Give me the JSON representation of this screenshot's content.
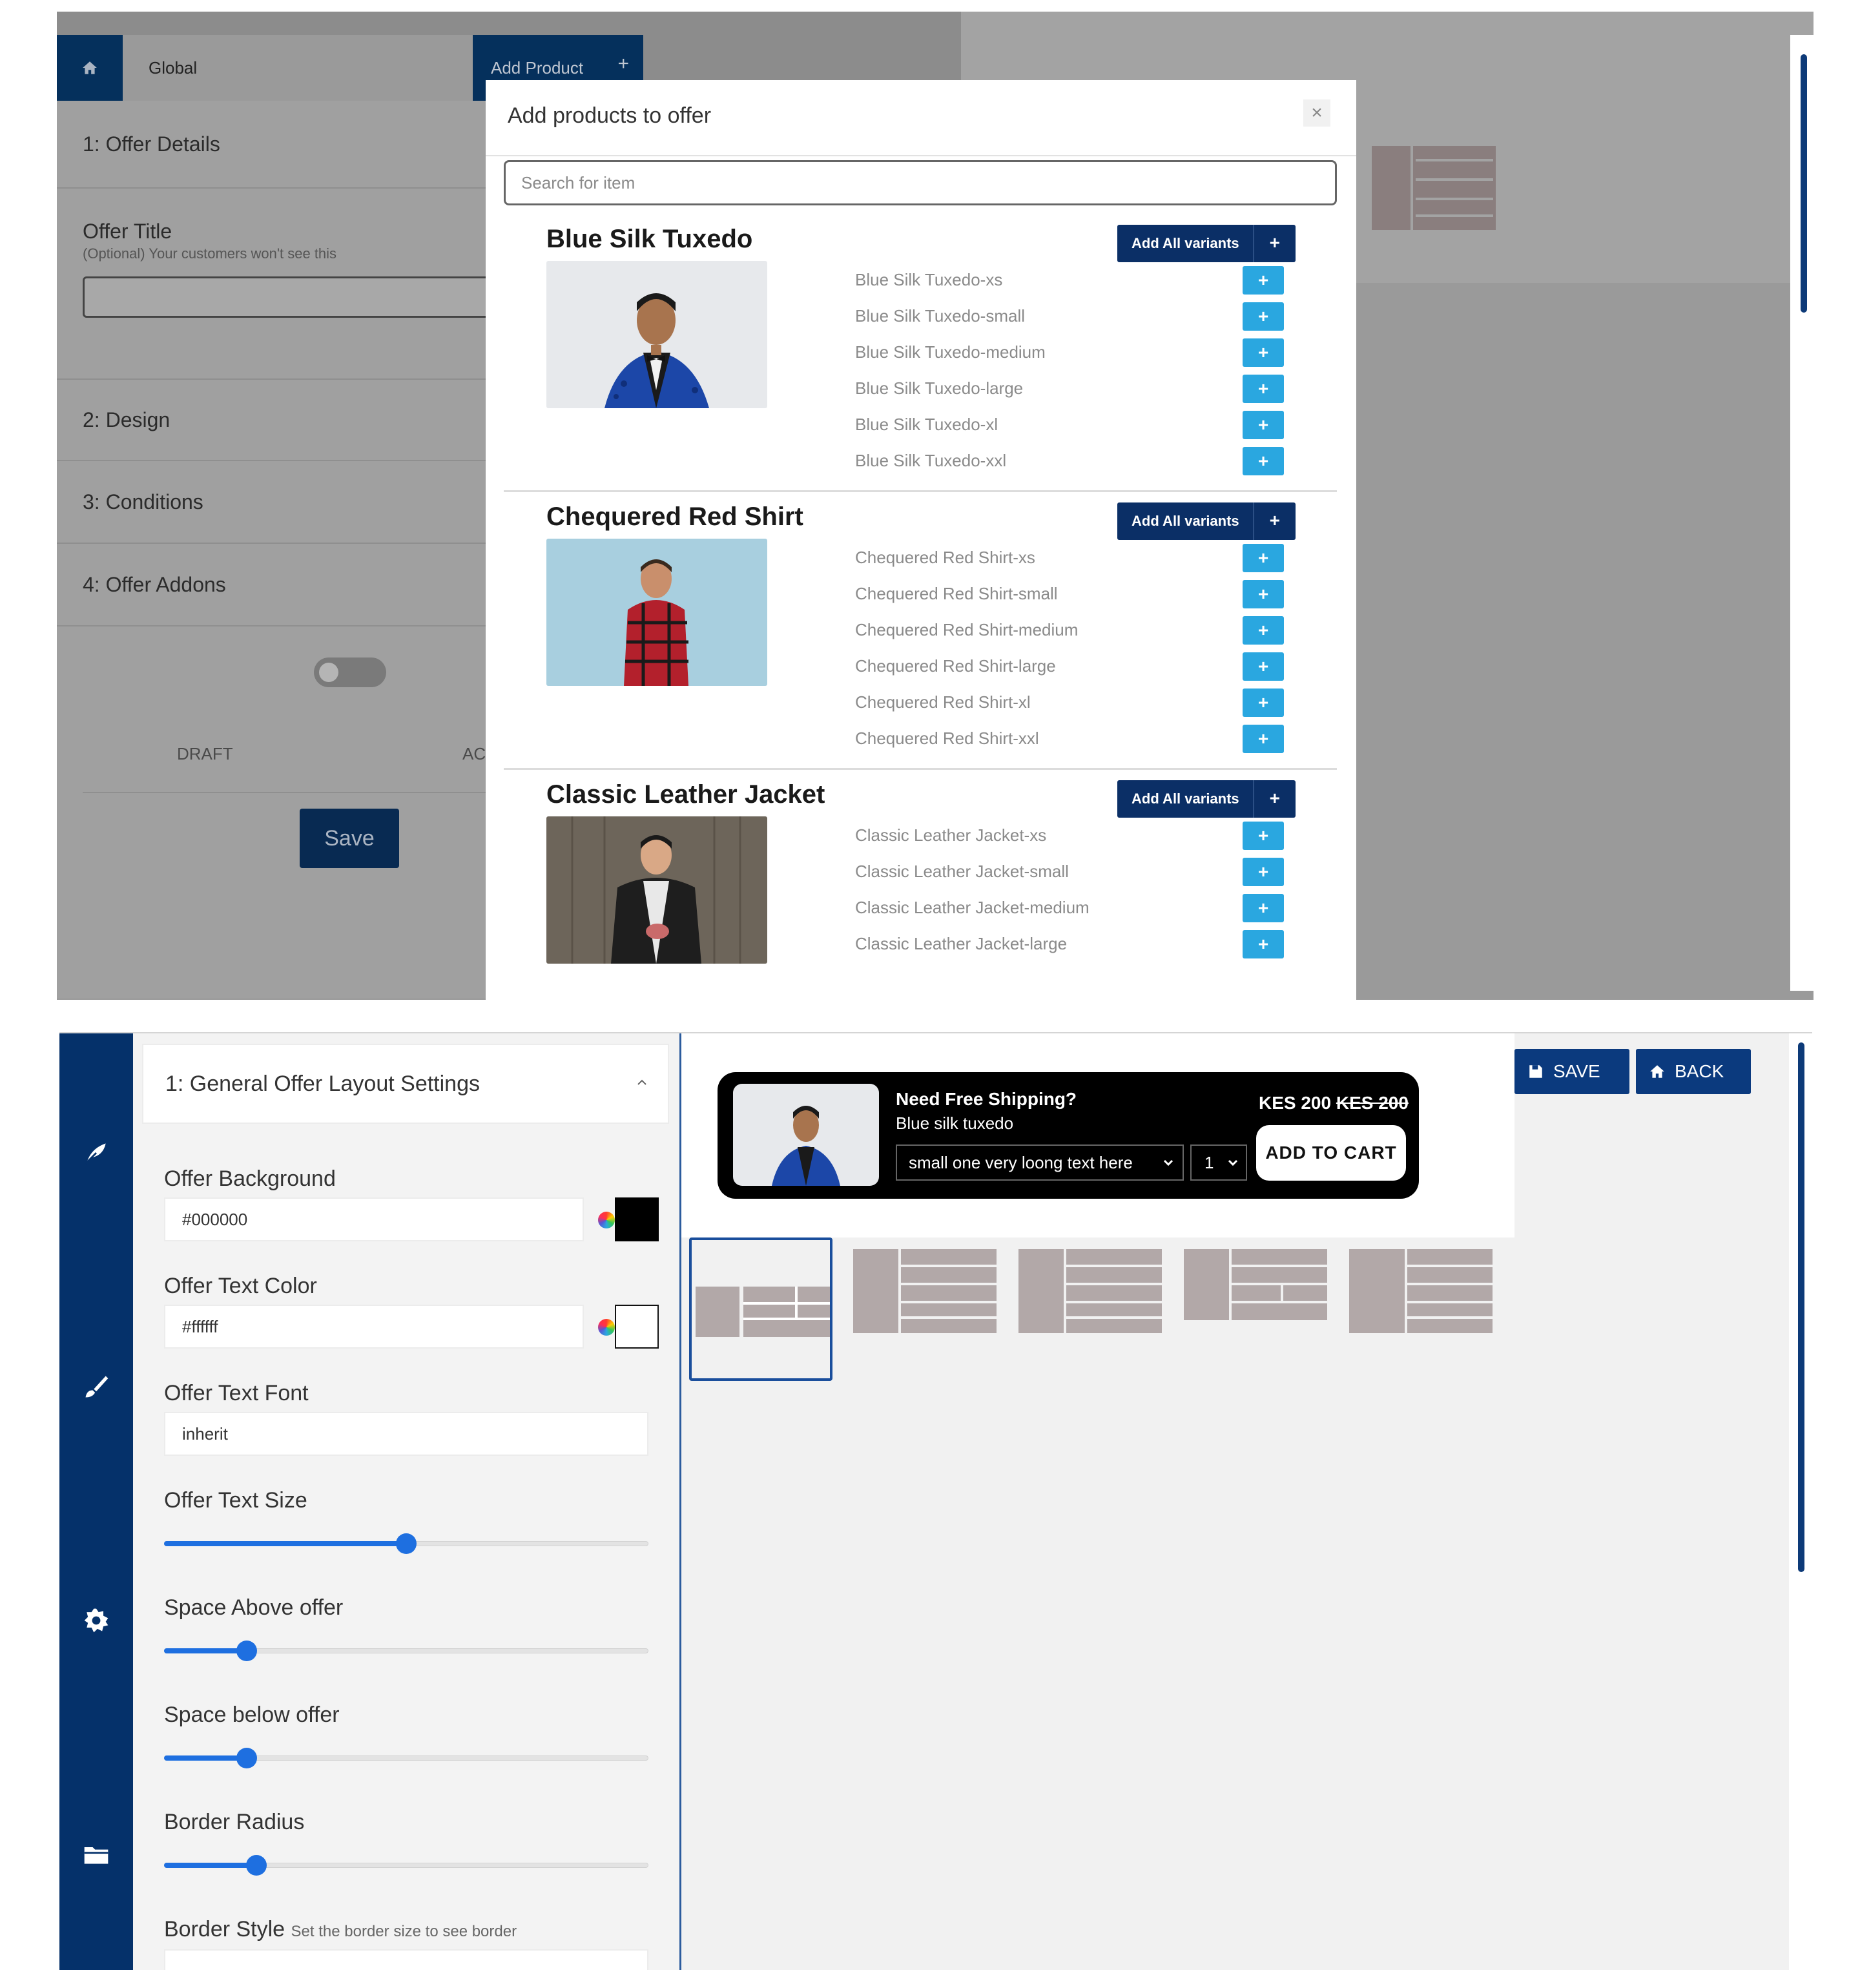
{
  "top": {
    "nav": {
      "scope": "Global",
      "add_product": "Add Product",
      "add_plus": "+"
    },
    "sections": [
      {
        "label": "1: Offer Details"
      },
      {
        "label": "2: Design"
      },
      {
        "label": "3: Conditions"
      },
      {
        "label": "4: Offer Addons"
      }
    ],
    "offer_title": {
      "label": "Offer Title",
      "hint": "(Optional) Your customers won't see this",
      "value": ""
    },
    "status": {
      "draft": "DRAFT",
      "active_partial": "AC"
    },
    "save_label": "Save",
    "modal": {
      "title": "Add products to offer",
      "close": "×",
      "search_placeholder": "Search for item",
      "add_all_label": "Add All variants",
      "add_all_plus": "+",
      "variant_plus": "+",
      "products": [
        {
          "name": "Blue Silk Tuxedo",
          "variants": [
            "Blue Silk Tuxedo-xs",
            "Blue Silk Tuxedo-small",
            "Blue Silk Tuxedo-medium",
            "Blue Silk Tuxedo-large",
            "Blue Silk Tuxedo-xl",
            "Blue Silk Tuxedo-xxl"
          ]
        },
        {
          "name": "Chequered Red Shirt",
          "variants": [
            "Chequered Red Shirt-xs",
            "Chequered Red Shirt-small",
            "Chequered Red Shirt-medium",
            "Chequered Red Shirt-large",
            "Chequered Red Shirt-xl",
            "Chequered Red Shirt-xxl"
          ]
        },
        {
          "name": "Classic Leather Jacket",
          "variants": [
            "Classic Leather Jacket-xs",
            "Classic Leather Jacket-small",
            "Classic Leather Jacket-medium",
            "Classic Leather Jacket-large"
          ]
        }
      ]
    }
  },
  "bottom": {
    "sidebar_icons": [
      "feather-icon",
      "brush-icon",
      "gear-icon",
      "folder-icon"
    ],
    "section_title": "1: General Offer Layout Settings",
    "fields": {
      "offer_background": {
        "label": "Offer Background",
        "value": "#000000",
        "swatch": "#000000"
      },
      "offer_text_color": {
        "label": "Offer Text Color",
        "value": "#ffffff",
        "swatch": "#ffffff"
      },
      "offer_text_font": {
        "label": "Offer Text Font",
        "value": "inherit"
      },
      "offer_text_size": {
        "label": "Offer Text Size",
        "level": 0.5
      },
      "space_above": {
        "label": "Space Above offer",
        "level": 0.17
      },
      "space_below": {
        "label": "Space below offer",
        "level": 0.17
      },
      "border_radius": {
        "label": "Border Radius",
        "level": 0.19
      },
      "border_style": {
        "label": "Border Style",
        "hint": "Set the border size to see border"
      }
    },
    "actions": {
      "save": "SAVE",
      "back": "BACK"
    },
    "preview": {
      "title": "Need Free Shipping?",
      "subtitle": "Blue silk tuxedo",
      "variant_select": "small one very loong text here",
      "qty": "1",
      "price": "KES 200",
      "compare_price": "KES 200",
      "cart_label": "ADD TO CART"
    },
    "layout_options_count": 5
  },
  "colors": {
    "brand_navy": "#05316a",
    "accent_blue": "#2aa7e0",
    "slider_blue": "#1e6fe0"
  }
}
